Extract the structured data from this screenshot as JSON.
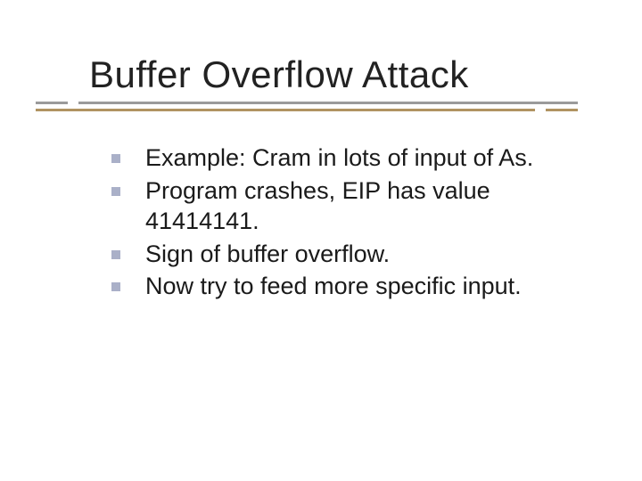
{
  "slide": {
    "title": "Buffer Overflow Attack",
    "bullets": [
      "Example: Cram in lots of input of As.",
      "Program crashes, EIP has value 41414141.",
      "Sign of buffer overflow.",
      "Now try to feed more specific input."
    ]
  },
  "colors": {
    "bullet_square": "#aab0c8",
    "underline_gray": "#9a9a9a",
    "underline_accent": "#b09361"
  }
}
